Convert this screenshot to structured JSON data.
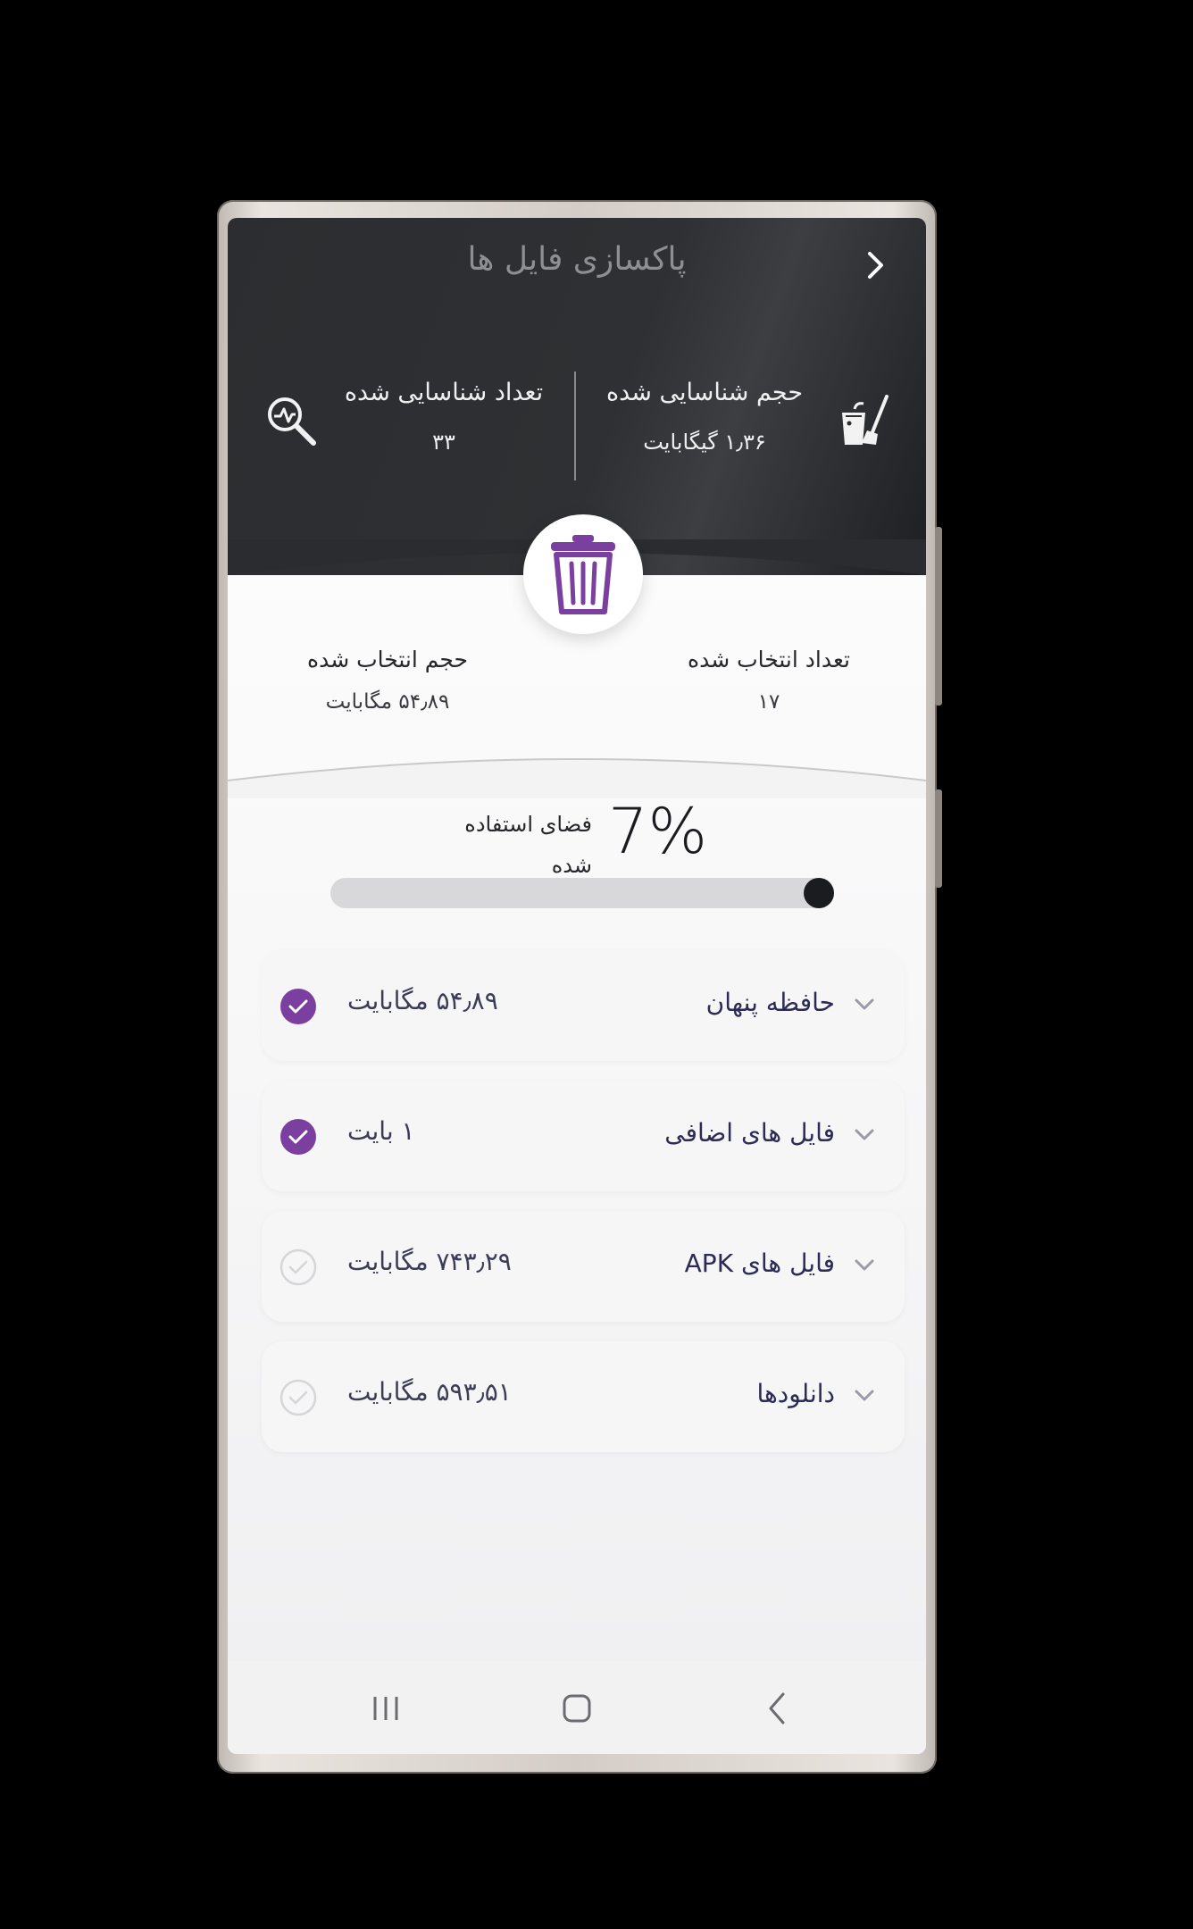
{
  "header": {
    "title": "پاکسازی فایل ها",
    "back_icon": "chevron-right-icon",
    "detected_size_label": "حجم شناسایی شده",
    "detected_size_value": "۱٫۳۶ گیگابایت",
    "detected_count_label": "تعداد شناسایی شده",
    "detected_count_value": "۳۳"
  },
  "selection": {
    "selected_count_label": "تعداد انتخاب شده",
    "selected_count_value": "۱۷",
    "selected_size_label": "حجم انتخاب شده",
    "selected_size_value": "۵۴٫۸۹ مگابایت"
  },
  "usage": {
    "percent_text": "7%",
    "percent_value": 0.07,
    "label": "فضای استفاده شده"
  },
  "items": [
    {
      "name": "حافظه پنهان",
      "size": "۵۴٫۸۹ مگابایت",
      "checked": true
    },
    {
      "name": "فایل های اضافی",
      "size": "۱ بایت",
      "checked": true
    },
    {
      "name": "فایل های APK",
      "size": "۷۴۳٫۲۹ مگابایت",
      "checked": false
    },
    {
      "name": "دانلودها",
      "size": "۵۹۳٫۵۱ مگابایت",
      "checked": false
    }
  ],
  "colors": {
    "accent": "#7b3fa0",
    "header_dark": "#2b2d30",
    "item_text": "#2b2b55"
  },
  "navbar": {
    "recents_icon": "recents-icon",
    "home_icon": "home-icon",
    "back_icon": "back-icon"
  }
}
